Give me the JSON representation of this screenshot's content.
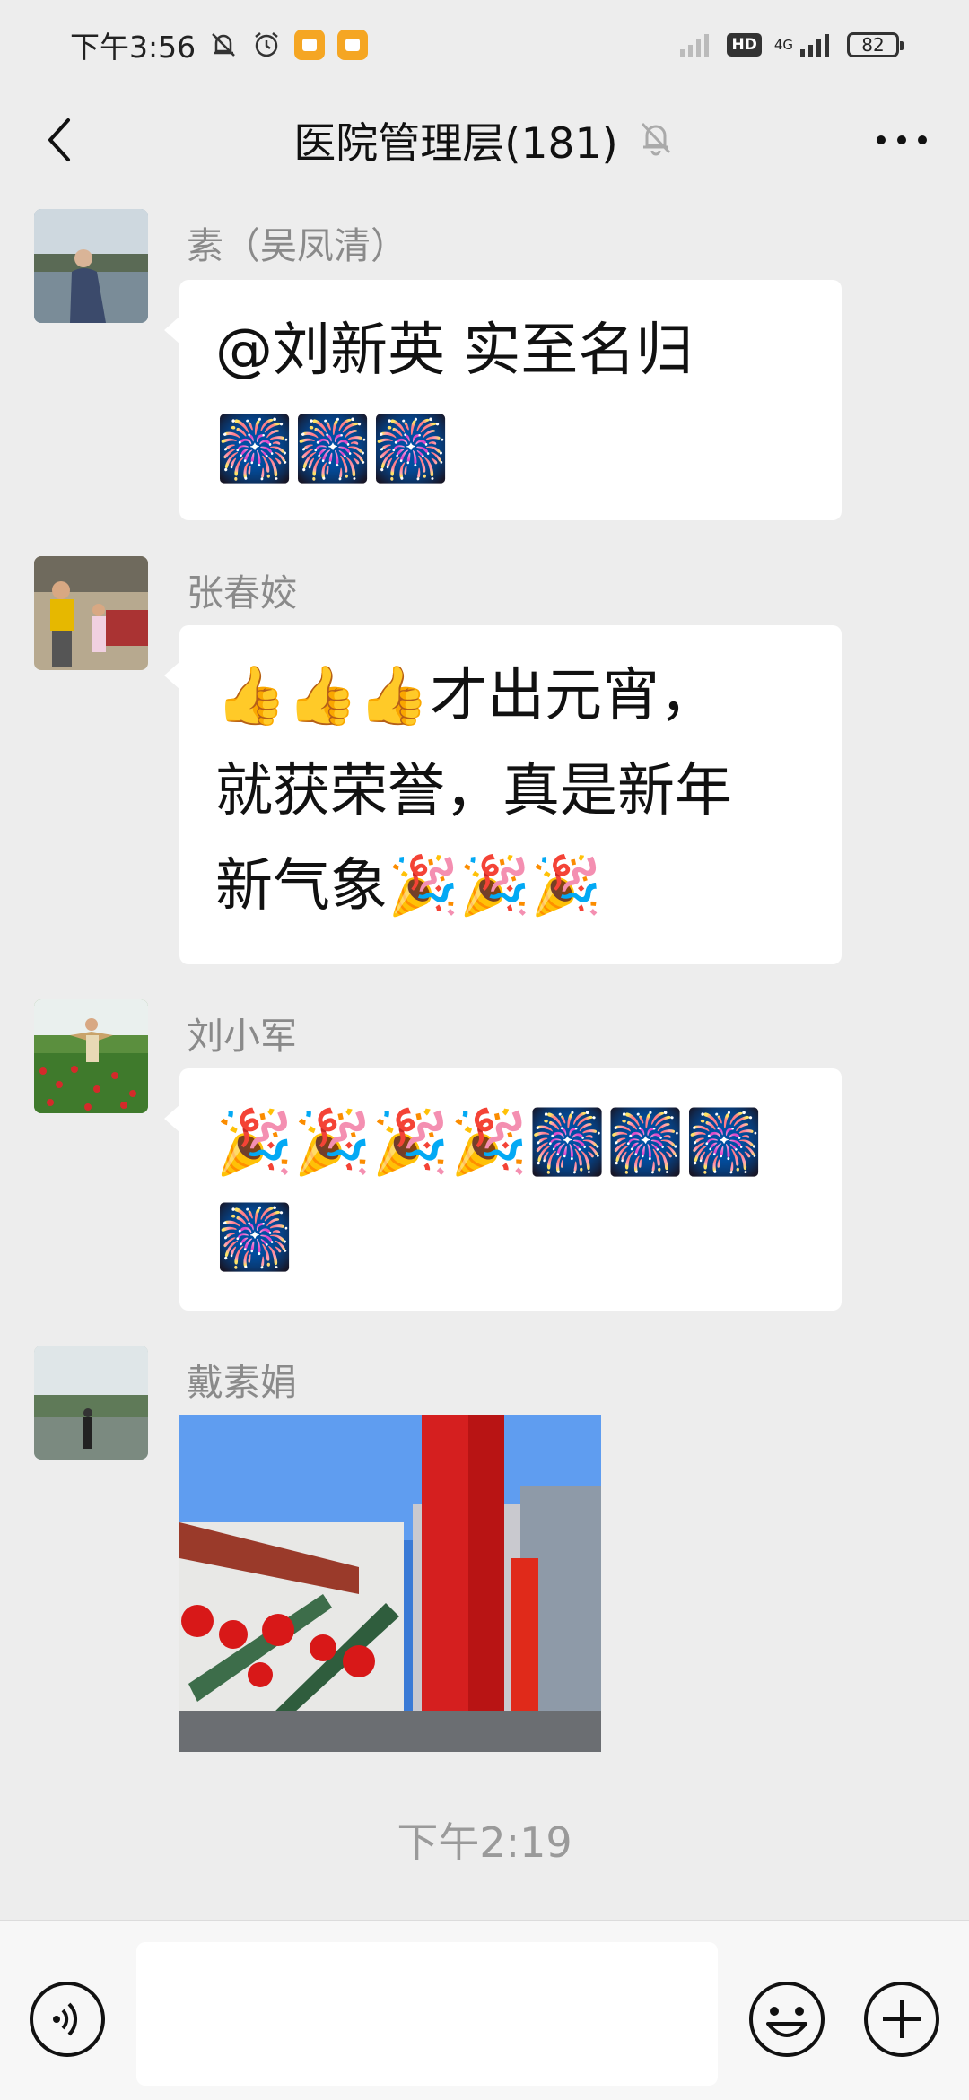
{
  "status_bar": {
    "time": "下午3:56",
    "network": "4G",
    "hd": "HD",
    "battery": "82"
  },
  "nav": {
    "title": "医院管理层(181)"
  },
  "messages": [
    {
      "sender": "素（吴凤清）",
      "lines": [
        "@刘新英  实至名归",
        "🎆🎆🎆"
      ]
    },
    {
      "sender": "张春姣",
      "lines": [
        "👍👍👍才出元宵，",
        "就获荣誉，真是新年",
        "新气象🎉🎉🎉"
      ]
    },
    {
      "sender": "刘小军",
      "lines": [
        "🎉🎉🎉🎉🎆🎆🎆",
        "🎆"
      ]
    },
    {
      "sender": "戴素娟"
    }
  ],
  "time_divider": "下午2:19",
  "colors": {
    "background": "#ededed",
    "bubble": "#ffffff",
    "sender": "#8a8a8a",
    "battery_badge": "#f5a623"
  }
}
